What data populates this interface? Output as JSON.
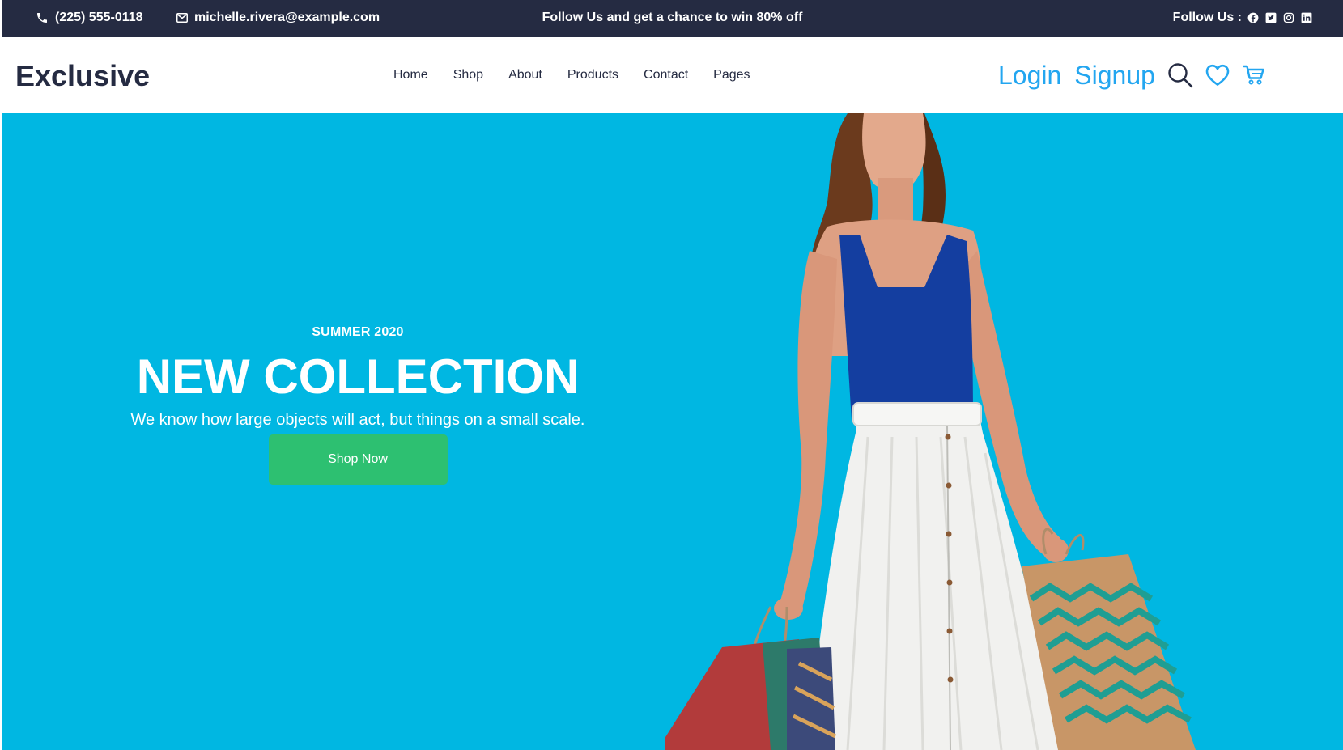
{
  "topbar": {
    "phone": "(225) 555-0118",
    "email": "michelle.rivera@example.com",
    "promo": "Follow Us  and get a chance to win 80% off",
    "follow_label": "Follow Us :",
    "socials": [
      "facebook-icon",
      "twitter-icon",
      "instagram-icon",
      "linkedin-icon"
    ],
    "background": "#252b42"
  },
  "navbar": {
    "brand": "Exclusive",
    "menu": [
      "Home",
      "Shop",
      "About",
      "Products",
      "Contact",
      "Pages"
    ],
    "login": "Login",
    "signup": "Signup",
    "icons": [
      "search-icon",
      "heart-icon",
      "cart-icon"
    ],
    "accent": "#23a6f0"
  },
  "hero": {
    "kicker": "SUMMER 2020",
    "title": "NEW COLLECTION",
    "subtitle": "We know how large objects will act, but things on a small scale.",
    "cta": "Shop Now",
    "background": "#00b7e2",
    "cta_color": "#2dc071"
  }
}
